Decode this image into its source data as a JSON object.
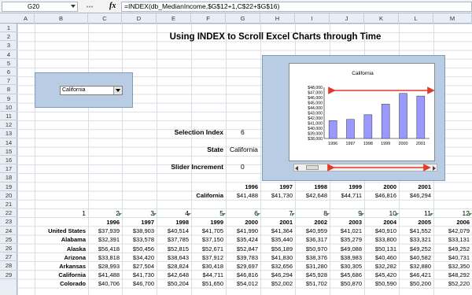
{
  "formula_bar": {
    "cell_ref": "G20",
    "fx": "fx",
    "formula": "=INDEX(db_MedianIncome,$G$12+1,C$22+$G$16)"
  },
  "columns": [
    "A",
    "B",
    "C",
    "D",
    "E",
    "F",
    "G",
    "H",
    "I",
    "J",
    "K",
    "L",
    "M"
  ],
  "rows": [
    "1",
    "2",
    "3",
    "4",
    "5",
    "6",
    "7",
    "8",
    "9",
    "10",
    "11",
    "12",
    "13",
    "14",
    "15",
    "16",
    "17",
    "18",
    "19",
    "20",
    "21",
    "22",
    "23",
    "24",
    "25",
    "26",
    "27",
    "28",
    "29"
  ],
  "title": "Using INDEX to Scroll Excel Charts through Time",
  "combo_value": "California",
  "controls": {
    "selection_index_label": "Selection Index",
    "selection_index_value": "6",
    "state_label": "State",
    "state_value": "California",
    "slider_label": "Slider Increment",
    "slider_value": "0"
  },
  "chart_data": {
    "type": "bar",
    "title": "California",
    "categories": [
      "1996",
      "1997",
      "1998",
      "1999",
      "2000",
      "2001"
    ],
    "values": [
      41488,
      41730,
      42648,
      44711,
      46816,
      46294
    ],
    "ylim": [
      38000,
      48000
    ],
    "yticks": [
      "$48,000",
      "$47,000",
      "$46,000",
      "$45,000",
      "$44,000",
      "$43,000",
      "$42,000",
      "$41,000",
      "$40,000",
      "$39,000",
      "$38,000"
    ],
    "bar_color": "#9999ff"
  },
  "summary": {
    "years": [
      "1996",
      "1997",
      "1998",
      "1999",
      "2000",
      "2001"
    ],
    "state": "California",
    "values": [
      "$41,488",
      "$41,730",
      "$42,648",
      "$44,711",
      "$46,816",
      "$46,294"
    ]
  },
  "table": {
    "indices": [
      "1",
      "2",
      "3",
      "4",
      "5",
      "6",
      "7",
      "8",
      "9",
      "10",
      "11",
      "12"
    ],
    "years": [
      "1996",
      "1997",
      "1998",
      "1999",
      "2000",
      "2001",
      "2002",
      "2003",
      "2004",
      "2005",
      "2006"
    ],
    "rows": [
      {
        "state": "United States",
        "vals": [
          "$37,939",
          "$38,903",
          "$40,514",
          "$41,705",
          "$41,990",
          "$41,364",
          "$40,959",
          "$41,021",
          "$40,910",
          "$41,552",
          "$42,079"
        ]
      },
      {
        "state": "Alabama",
        "vals": [
          "$32,391",
          "$33,578",
          "$37,785",
          "$37,150",
          "$35,424",
          "$35,440",
          "$36,317",
          "$35,279",
          "$33,800",
          "$33,321",
          "$33,131"
        ]
      },
      {
        "state": "Alaska",
        "vals": [
          "$56,418",
          "$50,456",
          "$52,815",
          "$52,671",
          "$52,847",
          "$56,189",
          "$50,970",
          "$49,088",
          "$50,131",
          "$49,252",
          "$49,252"
        ]
      },
      {
        "state": "Arizona",
        "vals": [
          "$33,818",
          "$34,420",
          "$38,643",
          "$37,912",
          "$39,783",
          "$41,830",
          "$38,376",
          "$38,983",
          "$40,460",
          "$40,582",
          "$40,731"
        ]
      },
      {
        "state": "Arkansas",
        "vals": [
          "$28,993",
          "$27,504",
          "$28,824",
          "$30,418",
          "$29,697",
          "$32,656",
          "$31,280",
          "$30,305",
          "$32,282",
          "$32,880",
          "$32,350"
        ]
      },
      {
        "state": "California",
        "vals": [
          "$41,488",
          "$41,730",
          "$42,648",
          "$44,711",
          "$46,816",
          "$46,294",
          "$45,928",
          "$45,686",
          "$45,420",
          "$46,421",
          "$48,292"
        ]
      },
      {
        "state": "Colorado",
        "vals": [
          "$40,706",
          "$46,700",
          "$50,204",
          "$51,650",
          "$54,012",
          "$52,002",
          "$51,702",
          "$50,870",
          "$50,590",
          "$50,200",
          "$52,220"
        ]
      }
    ]
  }
}
